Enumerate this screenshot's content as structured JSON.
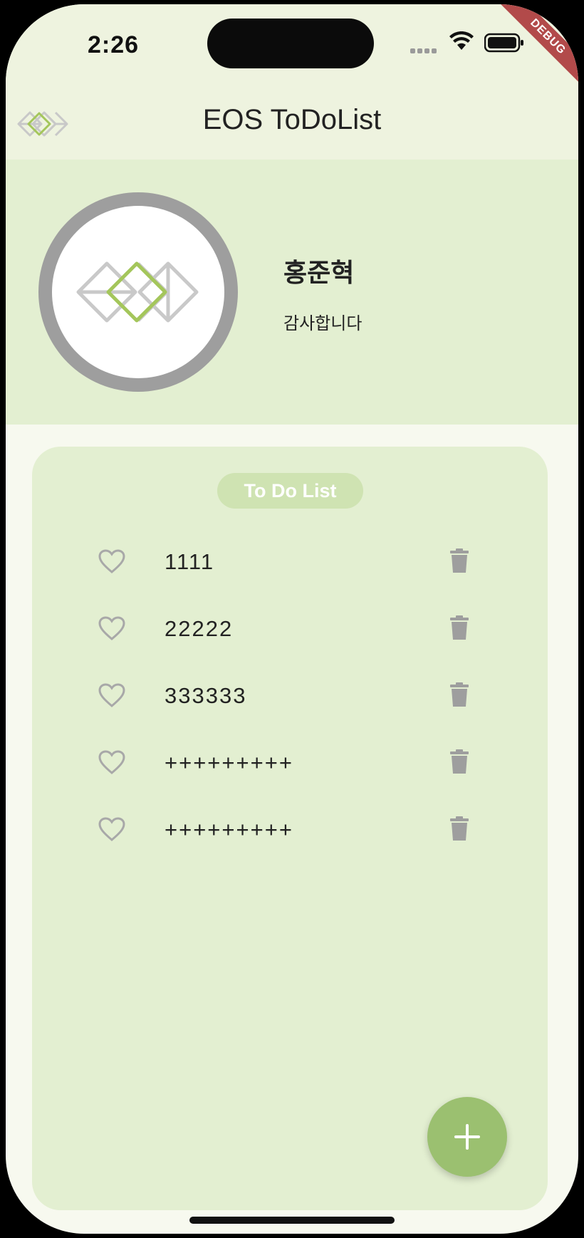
{
  "status_bar": {
    "time": "2:26",
    "debug_label": "DEBUG"
  },
  "app_bar": {
    "title": "EOS ToDoList",
    "logo_icon": "eos-logo-icon"
  },
  "profile": {
    "name": "홍준혁",
    "message": "감사합니다"
  },
  "todo": {
    "section_title": "To Do List",
    "items": [
      {
        "text": "1111"
      },
      {
        "text": "22222"
      },
      {
        "text": "333333"
      },
      {
        "text": "+++++++++"
      },
      {
        "text": "+++++++++"
      }
    ],
    "fab_icon": "plus-icon"
  },
  "colors": {
    "background": "#f7f9ef",
    "appbar": "#eef3df",
    "panel": "#e3efd1",
    "pill": "#cfe3b2",
    "fab": "#9bc070",
    "logo_green": "#a4c65b",
    "icon_gray": "#9e9e9e"
  }
}
